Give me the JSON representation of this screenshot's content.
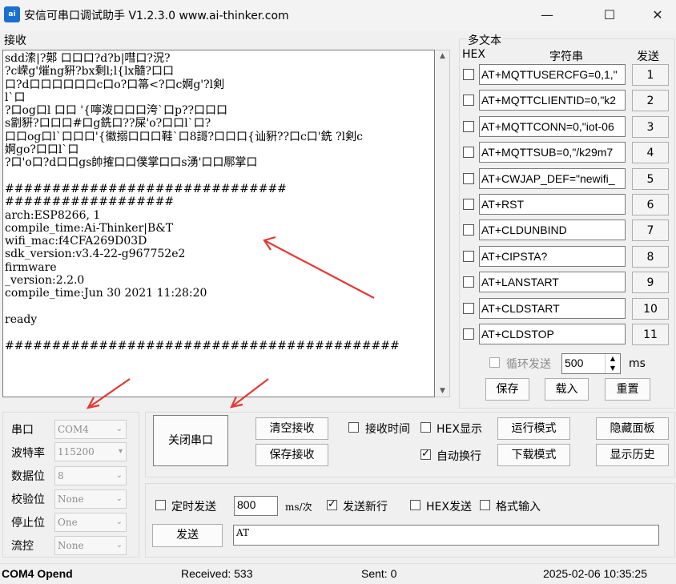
{
  "window": {
    "icon_text": "ai",
    "title": "安信可串口调试助手 V1.2.3.0    www.ai-thinker.com",
    "minimize": "—",
    "maximize": "☐",
    "close": "✕"
  },
  "receive": {
    "label": "接收",
    "lines": [
      "sdd溹|?鄚 口口口?d?b|嘒口?況?",
      "?c嵘g'熣ng豣?bx剩l;l{lx髓?口口",
      "口?d口口口口口口c口o?口箒<?口c婀g'?l剣",
      "l`口",
      "?口og口l 口口 '{嚀泼口口口洿`口p??口口口",
      "s劏豣?口口口#口g銑口??屎'o?口口l`口?",
      "口口og口l`口口口'{徽搦口口口鞋`口8謌?口口口{讪豣??口c口'銑 ?l剣c",
      "婀go?口口l`口",
      "?口'o口?d口口gs帥搉口口僕掌口口s湧'口口鄏掌口",
      "",
      "##############################",
      "##################",
      "arch:ESP8266, 1",
      "compile_time:Ai-Thinker|B&T",
      "wifi_mac:f4CFA269D03D",
      "sdk_version:v3.4-22-g967752e2",
      "firmware",
      "_version:2.2.0",
      "compile_time:Jun 30 2021 11:28:20",
      "",
      "ready",
      "",
      "##########################################"
    ]
  },
  "multi": {
    "title": "多文本",
    "col_hex": "HEX",
    "col_string": "字符串",
    "col_send": "发送",
    "rows": [
      {
        "text": "AT+MQTTUSERCFG=0,1,\"",
        "btn": "1"
      },
      {
        "text": "AT+MQTTCLIENTID=0,\"k2",
        "btn": "2"
      },
      {
        "text": "AT+MQTTCONN=0,\"iot-06",
        "btn": "3"
      },
      {
        "text": "AT+MQTTSUB=0,\"/k29m7",
        "btn": "4"
      },
      {
        "text": "AT+CWJAP_DEF=\"newifi_",
        "btn": "5"
      },
      {
        "text": "AT+RST",
        "btn": "6"
      },
      {
        "text": "AT+CLDUNBIND",
        "btn": "7"
      },
      {
        "text": "AT+CIPSTA?",
        "btn": "8"
      },
      {
        "text": "AT+LANSTART",
        "btn": "9"
      },
      {
        "text": "AT+CLDSTART",
        "btn": "10"
      },
      {
        "text": "AT+CLDSTOP",
        "btn": "11"
      }
    ],
    "loop_send_label": "循环发送",
    "loop_interval": "500",
    "ms": "ms",
    "save": "保存",
    "load": "载入",
    "reset": "重置"
  },
  "settings": {
    "port_label": "串口",
    "port_value": "COM4",
    "baud_label": "波特率",
    "baud_value": "115200",
    "data_label": "数据位",
    "data_value": "8",
    "parity_label": "校验位",
    "parity_value": "None",
    "stop_label": "停止位",
    "stop_value": "One",
    "flow_label": "流控",
    "flow_value": "None"
  },
  "controls": {
    "close_port": "关闭串口",
    "clear_receive": "清空接收",
    "save_receive": "保存接收",
    "receive_time": "接收时间",
    "hex_display": "HEX显示",
    "auto_wrap": "自动换行",
    "run_mode": "运行模式",
    "download_mode": "下载模式",
    "hide_panel": "隐藏面板",
    "show_history": "显示历史"
  },
  "send": {
    "timed_send": "定时发送",
    "interval": "800",
    "unit": "ms/次",
    "send_newline": "发送新行",
    "hex_send": "HEX发送",
    "format_input": "格式输入",
    "send_button": "发送",
    "send_text": "AT"
  },
  "status": {
    "port_state": "COM4 Opend",
    "received": "Received: 533",
    "sent": "Sent: 0",
    "datetime": "2025-02-06 10:35:25"
  },
  "colors": {
    "annotation_arrow": "#e53935"
  }
}
